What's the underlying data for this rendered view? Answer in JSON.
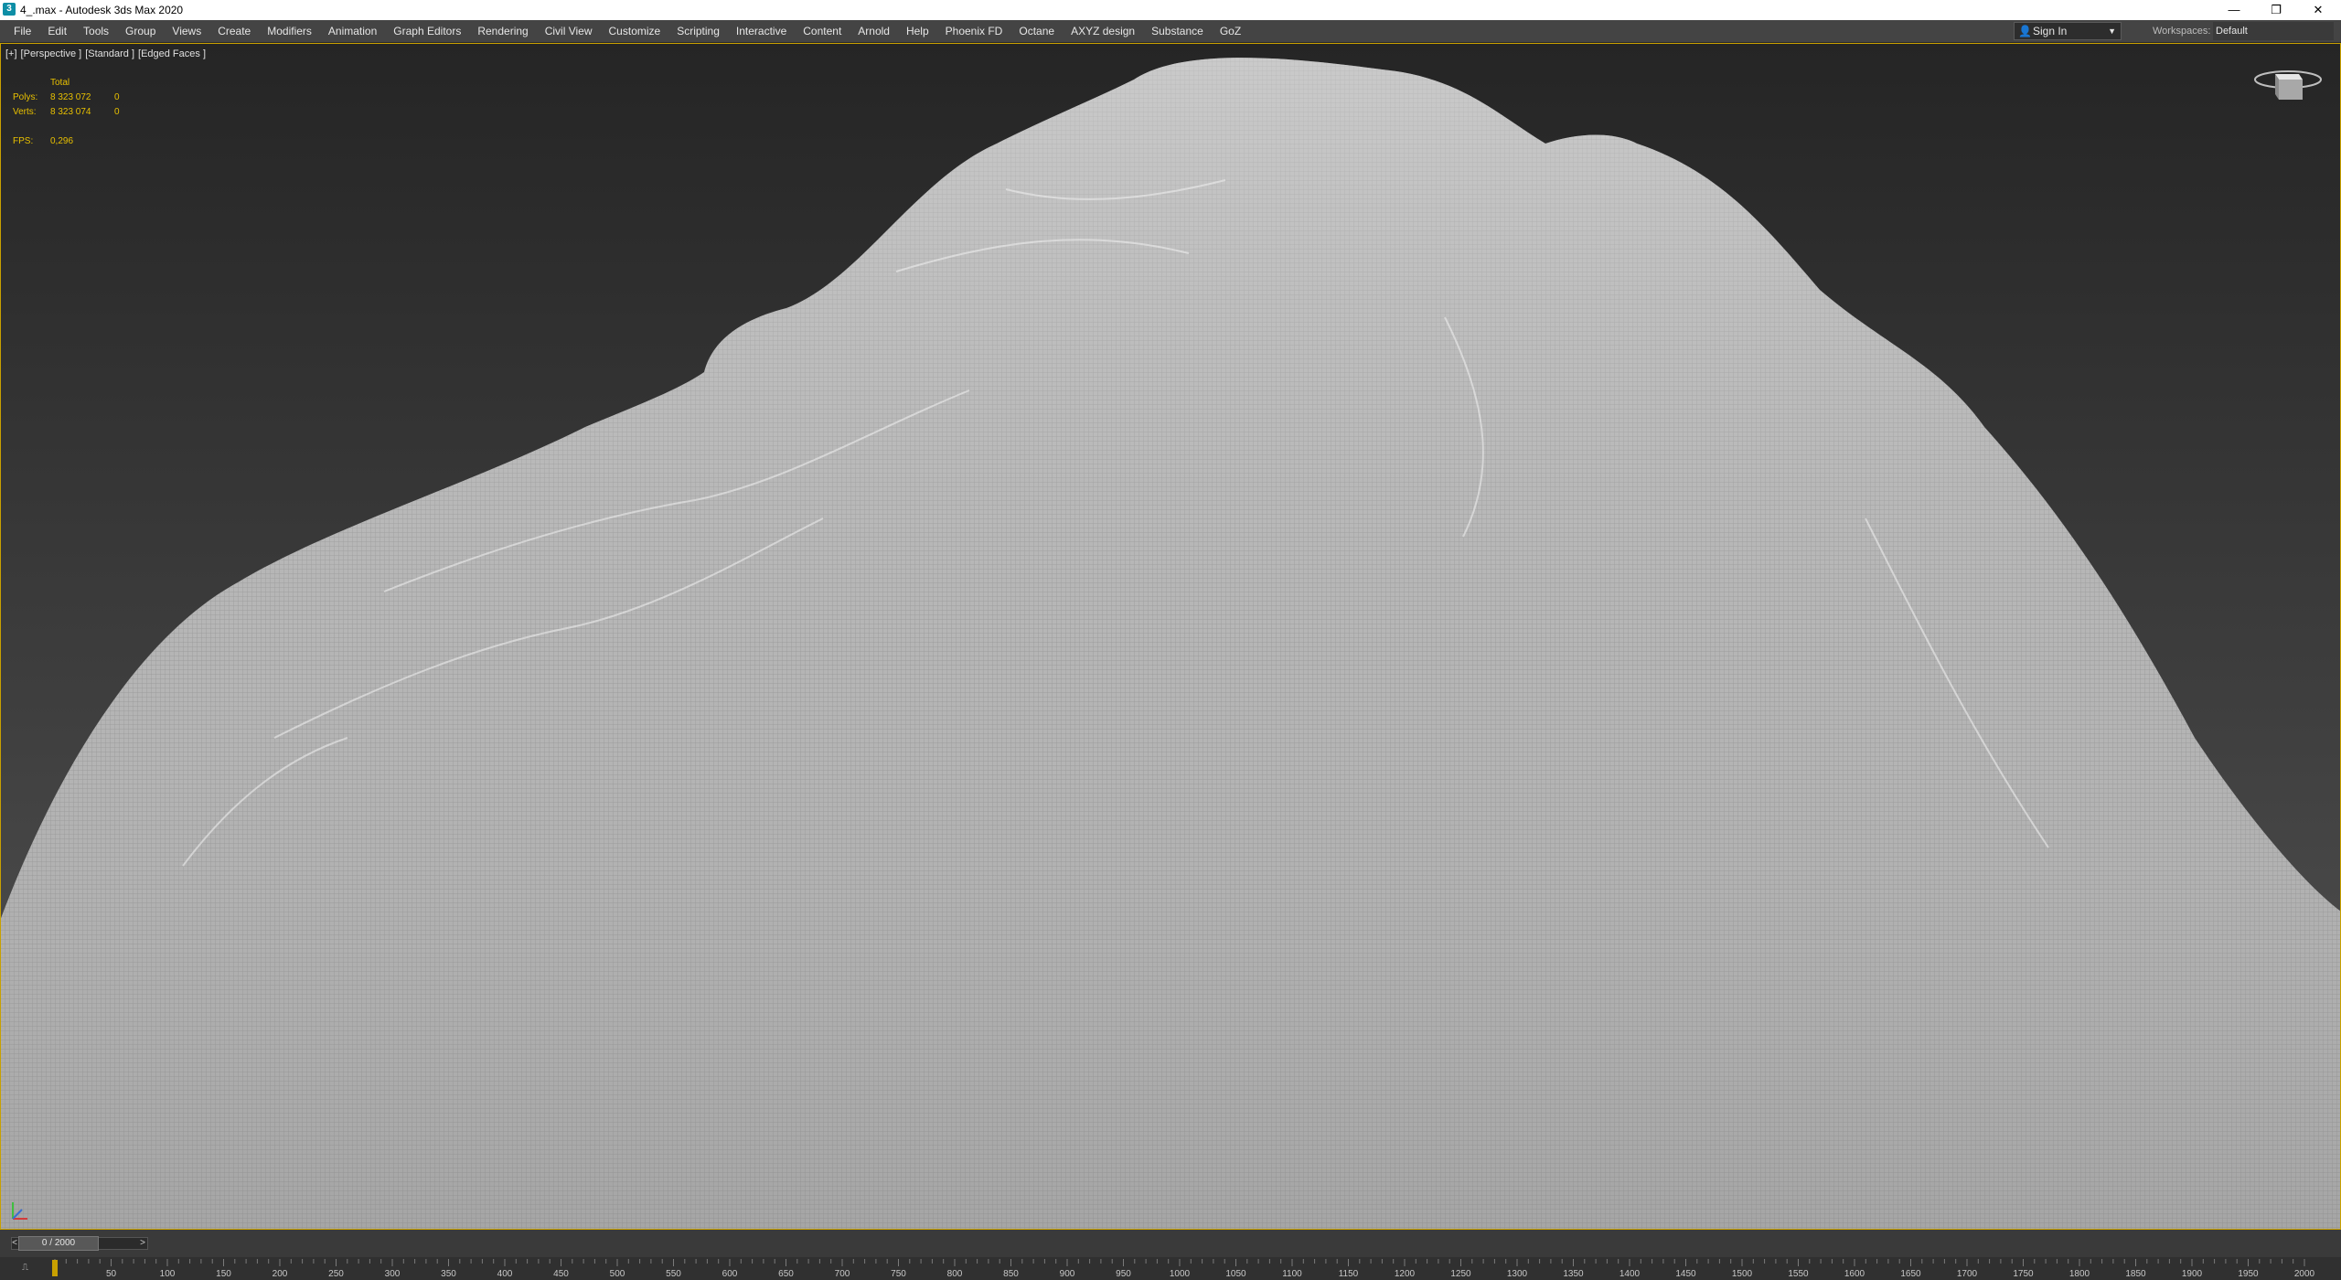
{
  "window": {
    "title": "4_.max - Autodesk 3ds Max 2020",
    "icon": "3ds-max-app-icon",
    "minimize_glyph": "—",
    "restore_glyph": "❐",
    "close_glyph": "✕"
  },
  "menu": {
    "items": [
      "File",
      "Edit",
      "Tools",
      "Group",
      "Views",
      "Create",
      "Modifiers",
      "Animation",
      "Graph Editors",
      "Rendering",
      "Civil View",
      "Customize",
      "Scripting",
      "Interactive",
      "Content",
      "Arnold",
      "Help",
      "Phoenix FD",
      "Octane",
      "AXYZ design",
      "Substance",
      "GoZ"
    ],
    "sign_in": "Sign In",
    "workspaces_label": "Workspaces:",
    "workspace_value": "Default"
  },
  "viewport": {
    "labels": [
      "[+]",
      "[Perspective ]",
      "[Standard ]",
      "[Edged Faces ]"
    ],
    "stats": {
      "header": "Total",
      "polys_label": "Polys:",
      "polys_total": "8 323 072",
      "polys_selected": "0",
      "verts_label": "Verts:",
      "verts_total": "8 323 074",
      "verts_selected": "0",
      "fps_label": "FPS:",
      "fps_value": "0,296"
    },
    "mesh_color": "#c9c9c9",
    "highlight_border": "#c8a000"
  },
  "timeslider": {
    "position_text": "0 / 2000",
    "prev": "<",
    "next": ">"
  },
  "trackbar": {
    "ticks": [
      50,
      100,
      150,
      200,
      250,
      300,
      350,
      400,
      450,
      500,
      550,
      600,
      650,
      700,
      750,
      800,
      850,
      900,
      950,
      1000,
      1050,
      1100,
      1150,
      1200,
      1250,
      1300,
      1350,
      1400,
      1450,
      1500,
      1550,
      1600,
      1650,
      1700,
      1750,
      1800,
      1850,
      1900,
      1950,
      2000
    ],
    "max_frame": 2000,
    "current_frame": 0
  }
}
